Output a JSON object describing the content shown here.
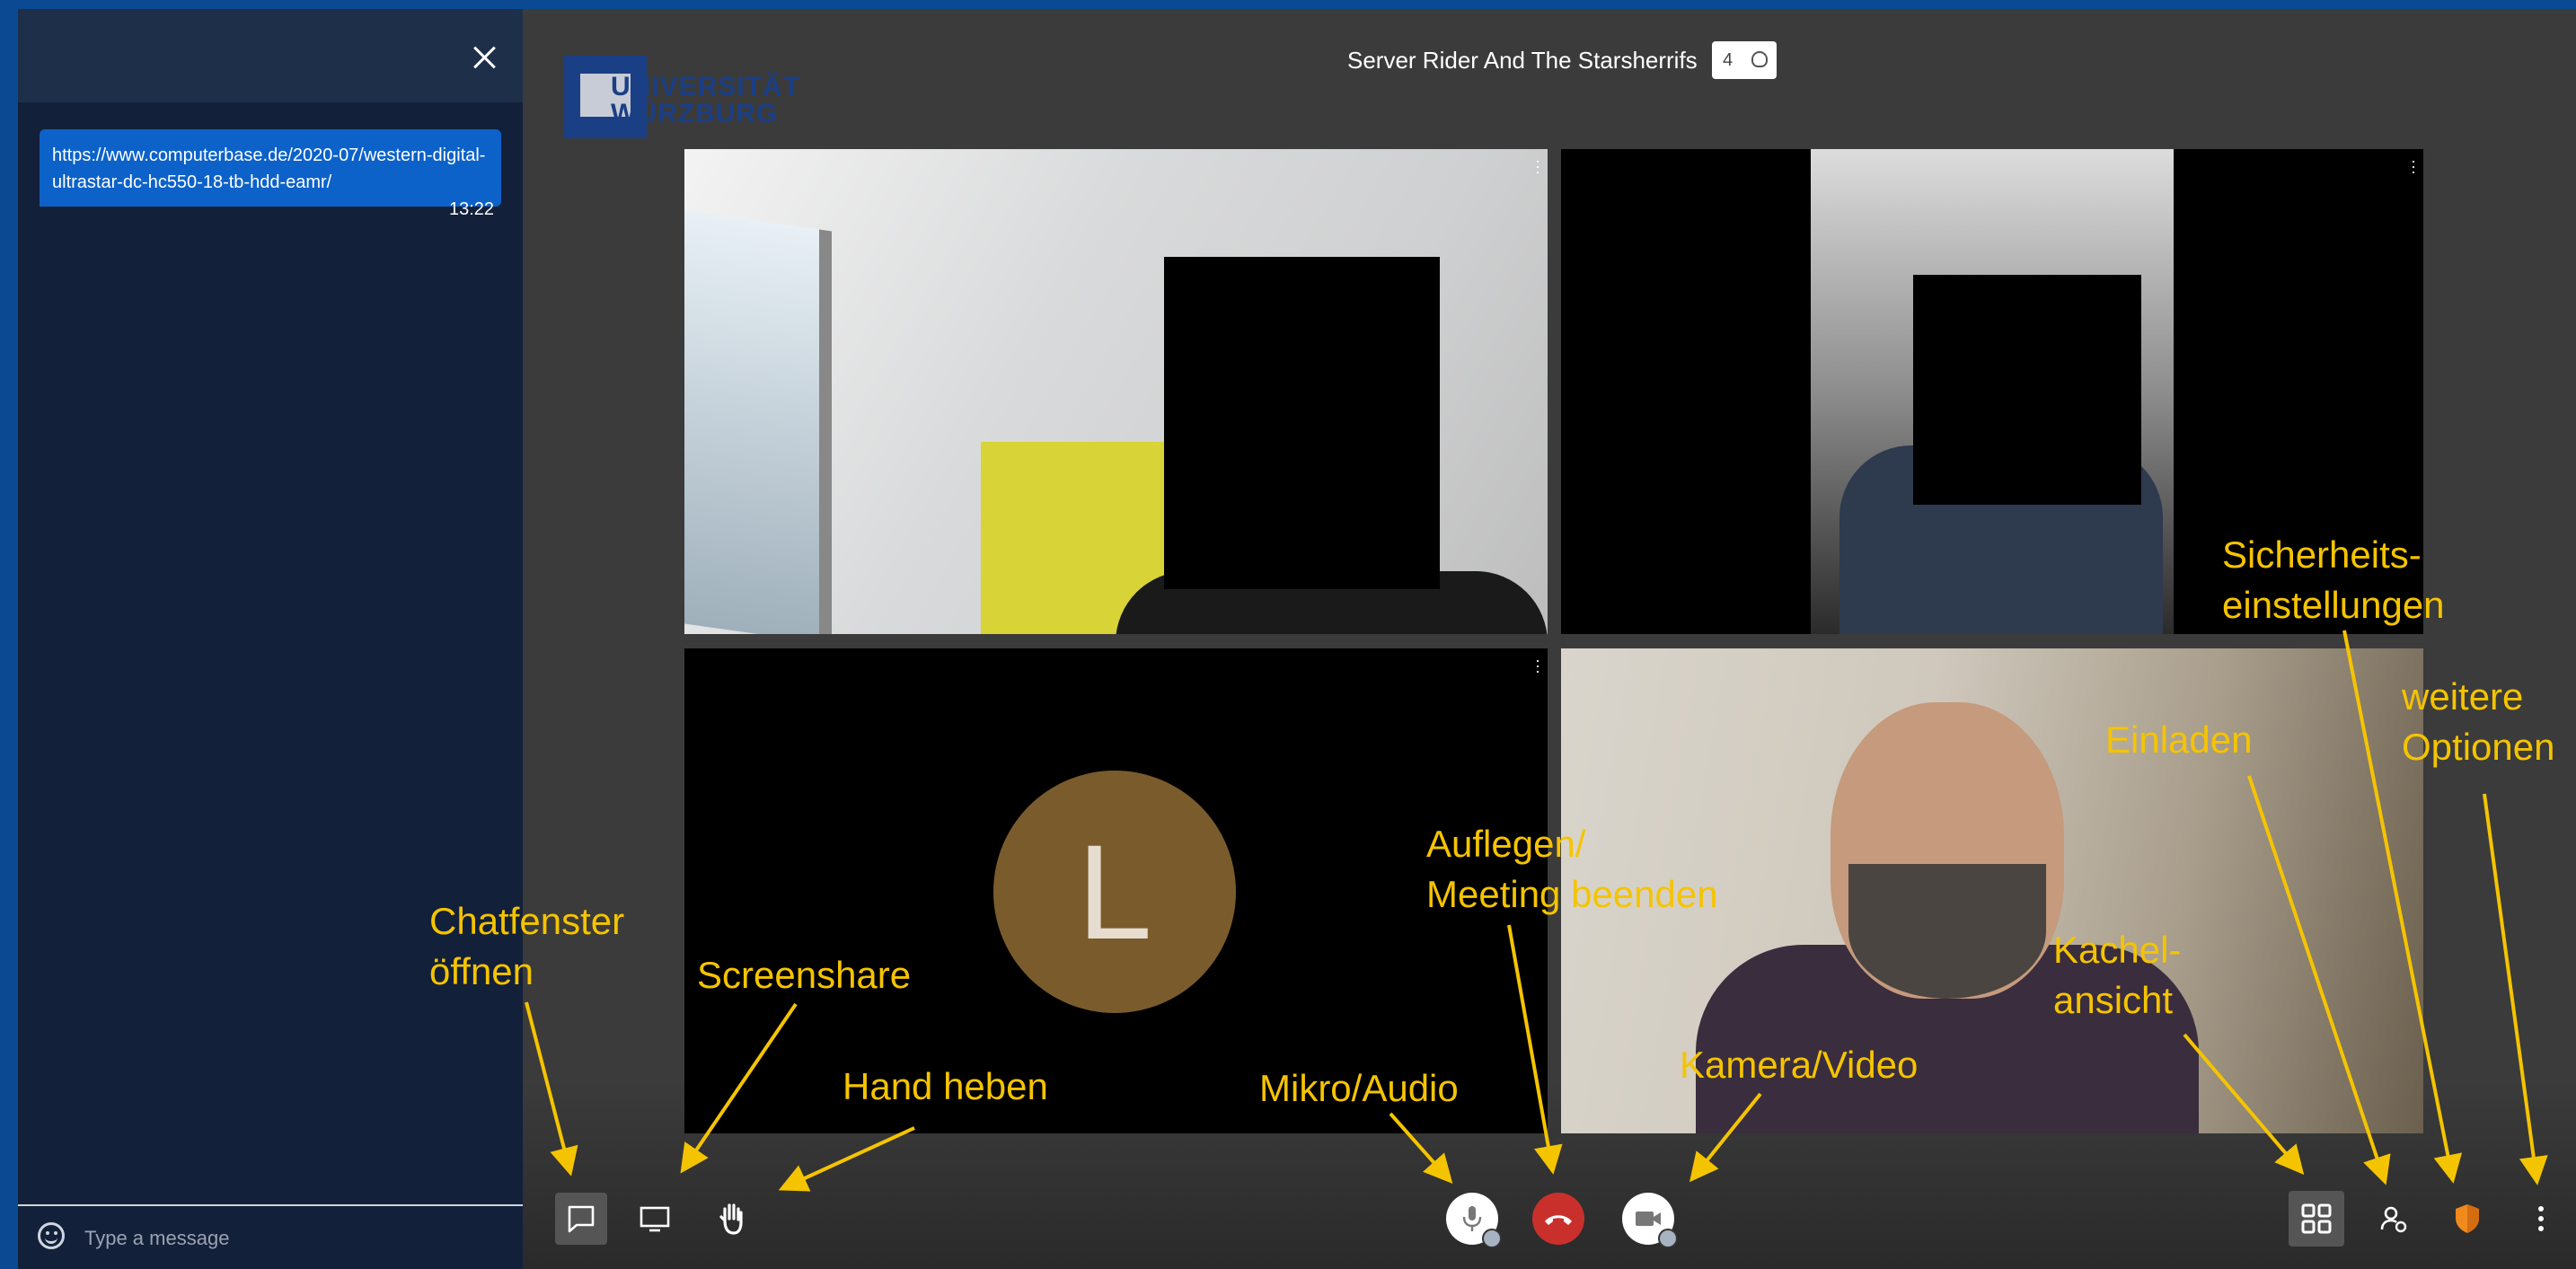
{
  "chat": {
    "message_text": "https://www.computerbase.de/2020-07/western-digital-ultrastar-dc-hc550-18-tb-hdd-eamr/",
    "message_time": "13:22",
    "input_placeholder": "Type a message"
  },
  "meeting": {
    "title": "Server Rider And The Starsherrifs",
    "participant_count": "4",
    "logo_line1": "UNIVERSITÄT",
    "logo_line2": "WÜRZBURG"
  },
  "tiles": [
    {
      "type": "video"
    },
    {
      "type": "video"
    },
    {
      "type": "avatar",
      "initial": "L"
    },
    {
      "type": "video"
    }
  ],
  "annotations": {
    "chat": "Chatfenster\nöffnen",
    "screenshare": "Screenshare",
    "hand": "Hand heben",
    "mic": "Mikro/Audio",
    "hangup": "Auflegen/\nMeeting beenden",
    "camera": "Kamera/Video",
    "tile": "Kachel-\nansicht",
    "invite": "Einladen",
    "security": "Sicherheits-\neinstellungen",
    "more": "weitere\nOptionen"
  },
  "colors": {
    "annotation": "#f5c400",
    "hangup": "#c9302c",
    "chat_bubble": "#0c62c9",
    "background": "#0b4a93"
  }
}
